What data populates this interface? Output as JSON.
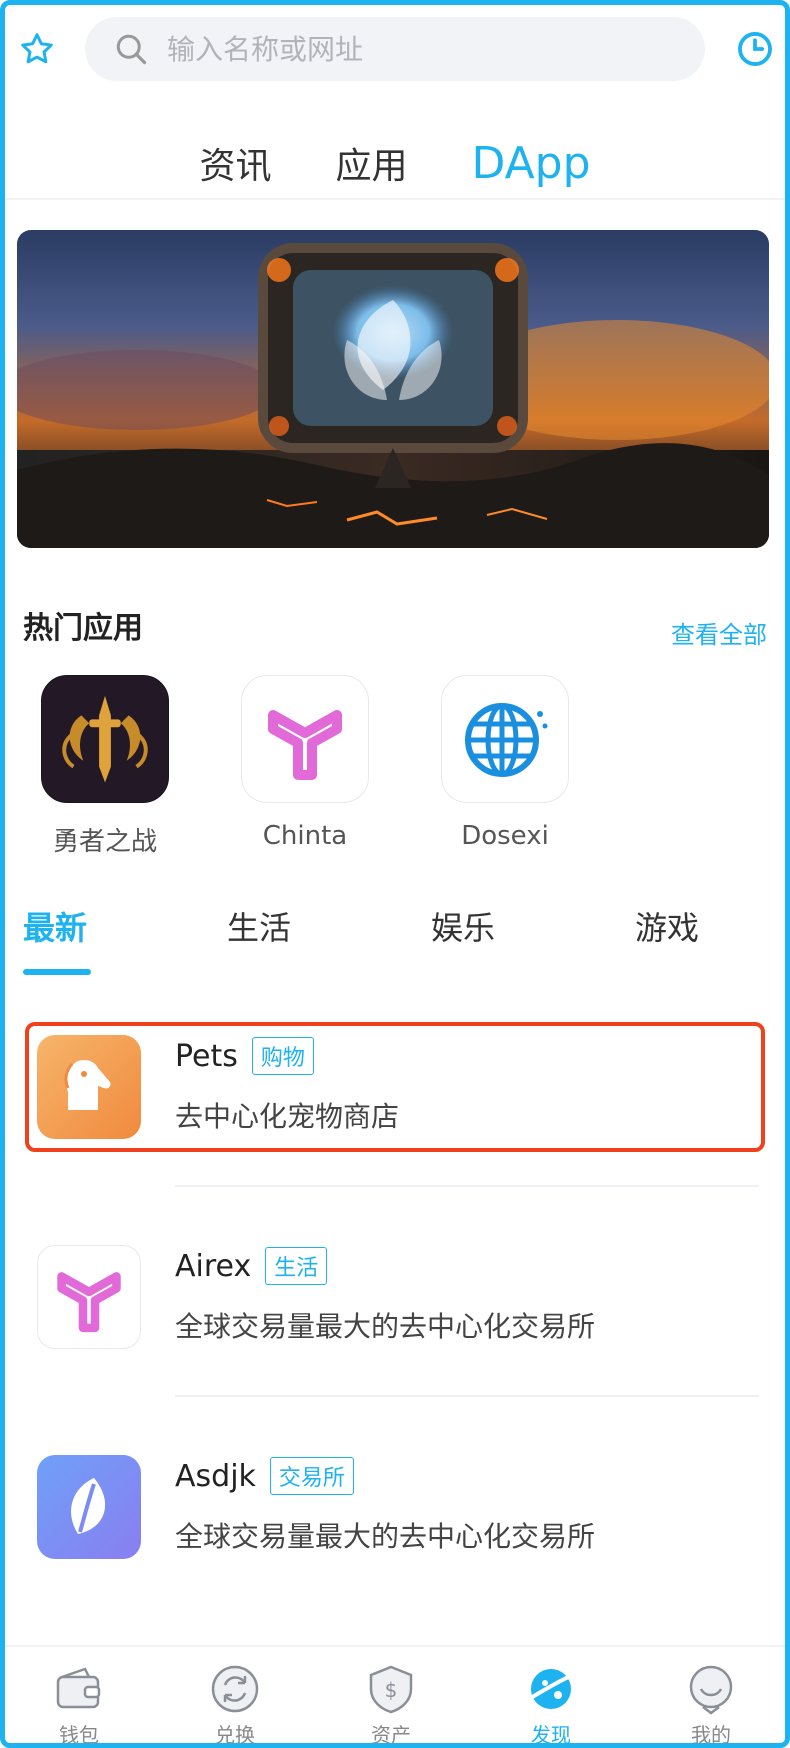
{
  "search": {
    "placeholder": "输入名称或网址",
    "star_icon": "star-icon",
    "clock_icon": "clock-icon"
  },
  "main_tabs": [
    {
      "label": "资讯",
      "active": false
    },
    {
      "label": "应用",
      "active": false
    },
    {
      "label": "DApp",
      "active": true
    }
  ],
  "hot_section": {
    "title": "热门应用",
    "see_all": "查看全部",
    "apps": [
      {
        "name": "勇者之战",
        "icon": "sword-emblem-icon"
      },
      {
        "name": "Chinta",
        "icon": "y-logo-icon"
      },
      {
        "name": "Dosexi",
        "icon": "globe-icon"
      }
    ]
  },
  "category_tabs": [
    {
      "label": "最新",
      "active": true
    },
    {
      "label": "生活",
      "active": false
    },
    {
      "label": "娱乐",
      "active": false
    },
    {
      "label": "游戏",
      "active": false
    }
  ],
  "list": [
    {
      "title": "Pets",
      "tag": "购物",
      "desc": "去中心化宠物商店",
      "icon": "dog-icon",
      "highlighted": true
    },
    {
      "title": "Airex",
      "tag": "生活",
      "desc": "全球交易量最大的去中心化交易所",
      "icon": "y-logo-icon"
    },
    {
      "title": "Asdjk",
      "tag": "交易所",
      "desc": "全球交易量最大的去中心化交易所",
      "icon": "leaf-icon"
    }
  ],
  "bottom_nav": [
    {
      "label": "钱包",
      "icon": "wallet-icon",
      "active": false
    },
    {
      "label": "兑换",
      "icon": "exchange-icon",
      "active": false
    },
    {
      "label": "资产",
      "icon": "shield-dollar-icon",
      "active": false
    },
    {
      "label": "发现",
      "icon": "planet-icon",
      "active": true
    },
    {
      "label": "我的",
      "icon": "profile-icon",
      "active": false
    }
  ],
  "colors": {
    "accent": "#1db2f0",
    "highlight_border": "#f0401e",
    "pets_icon": "#f39a4c",
    "asdjk_icon": "#7a8cf5",
    "y_logo": "#e16ad8"
  }
}
